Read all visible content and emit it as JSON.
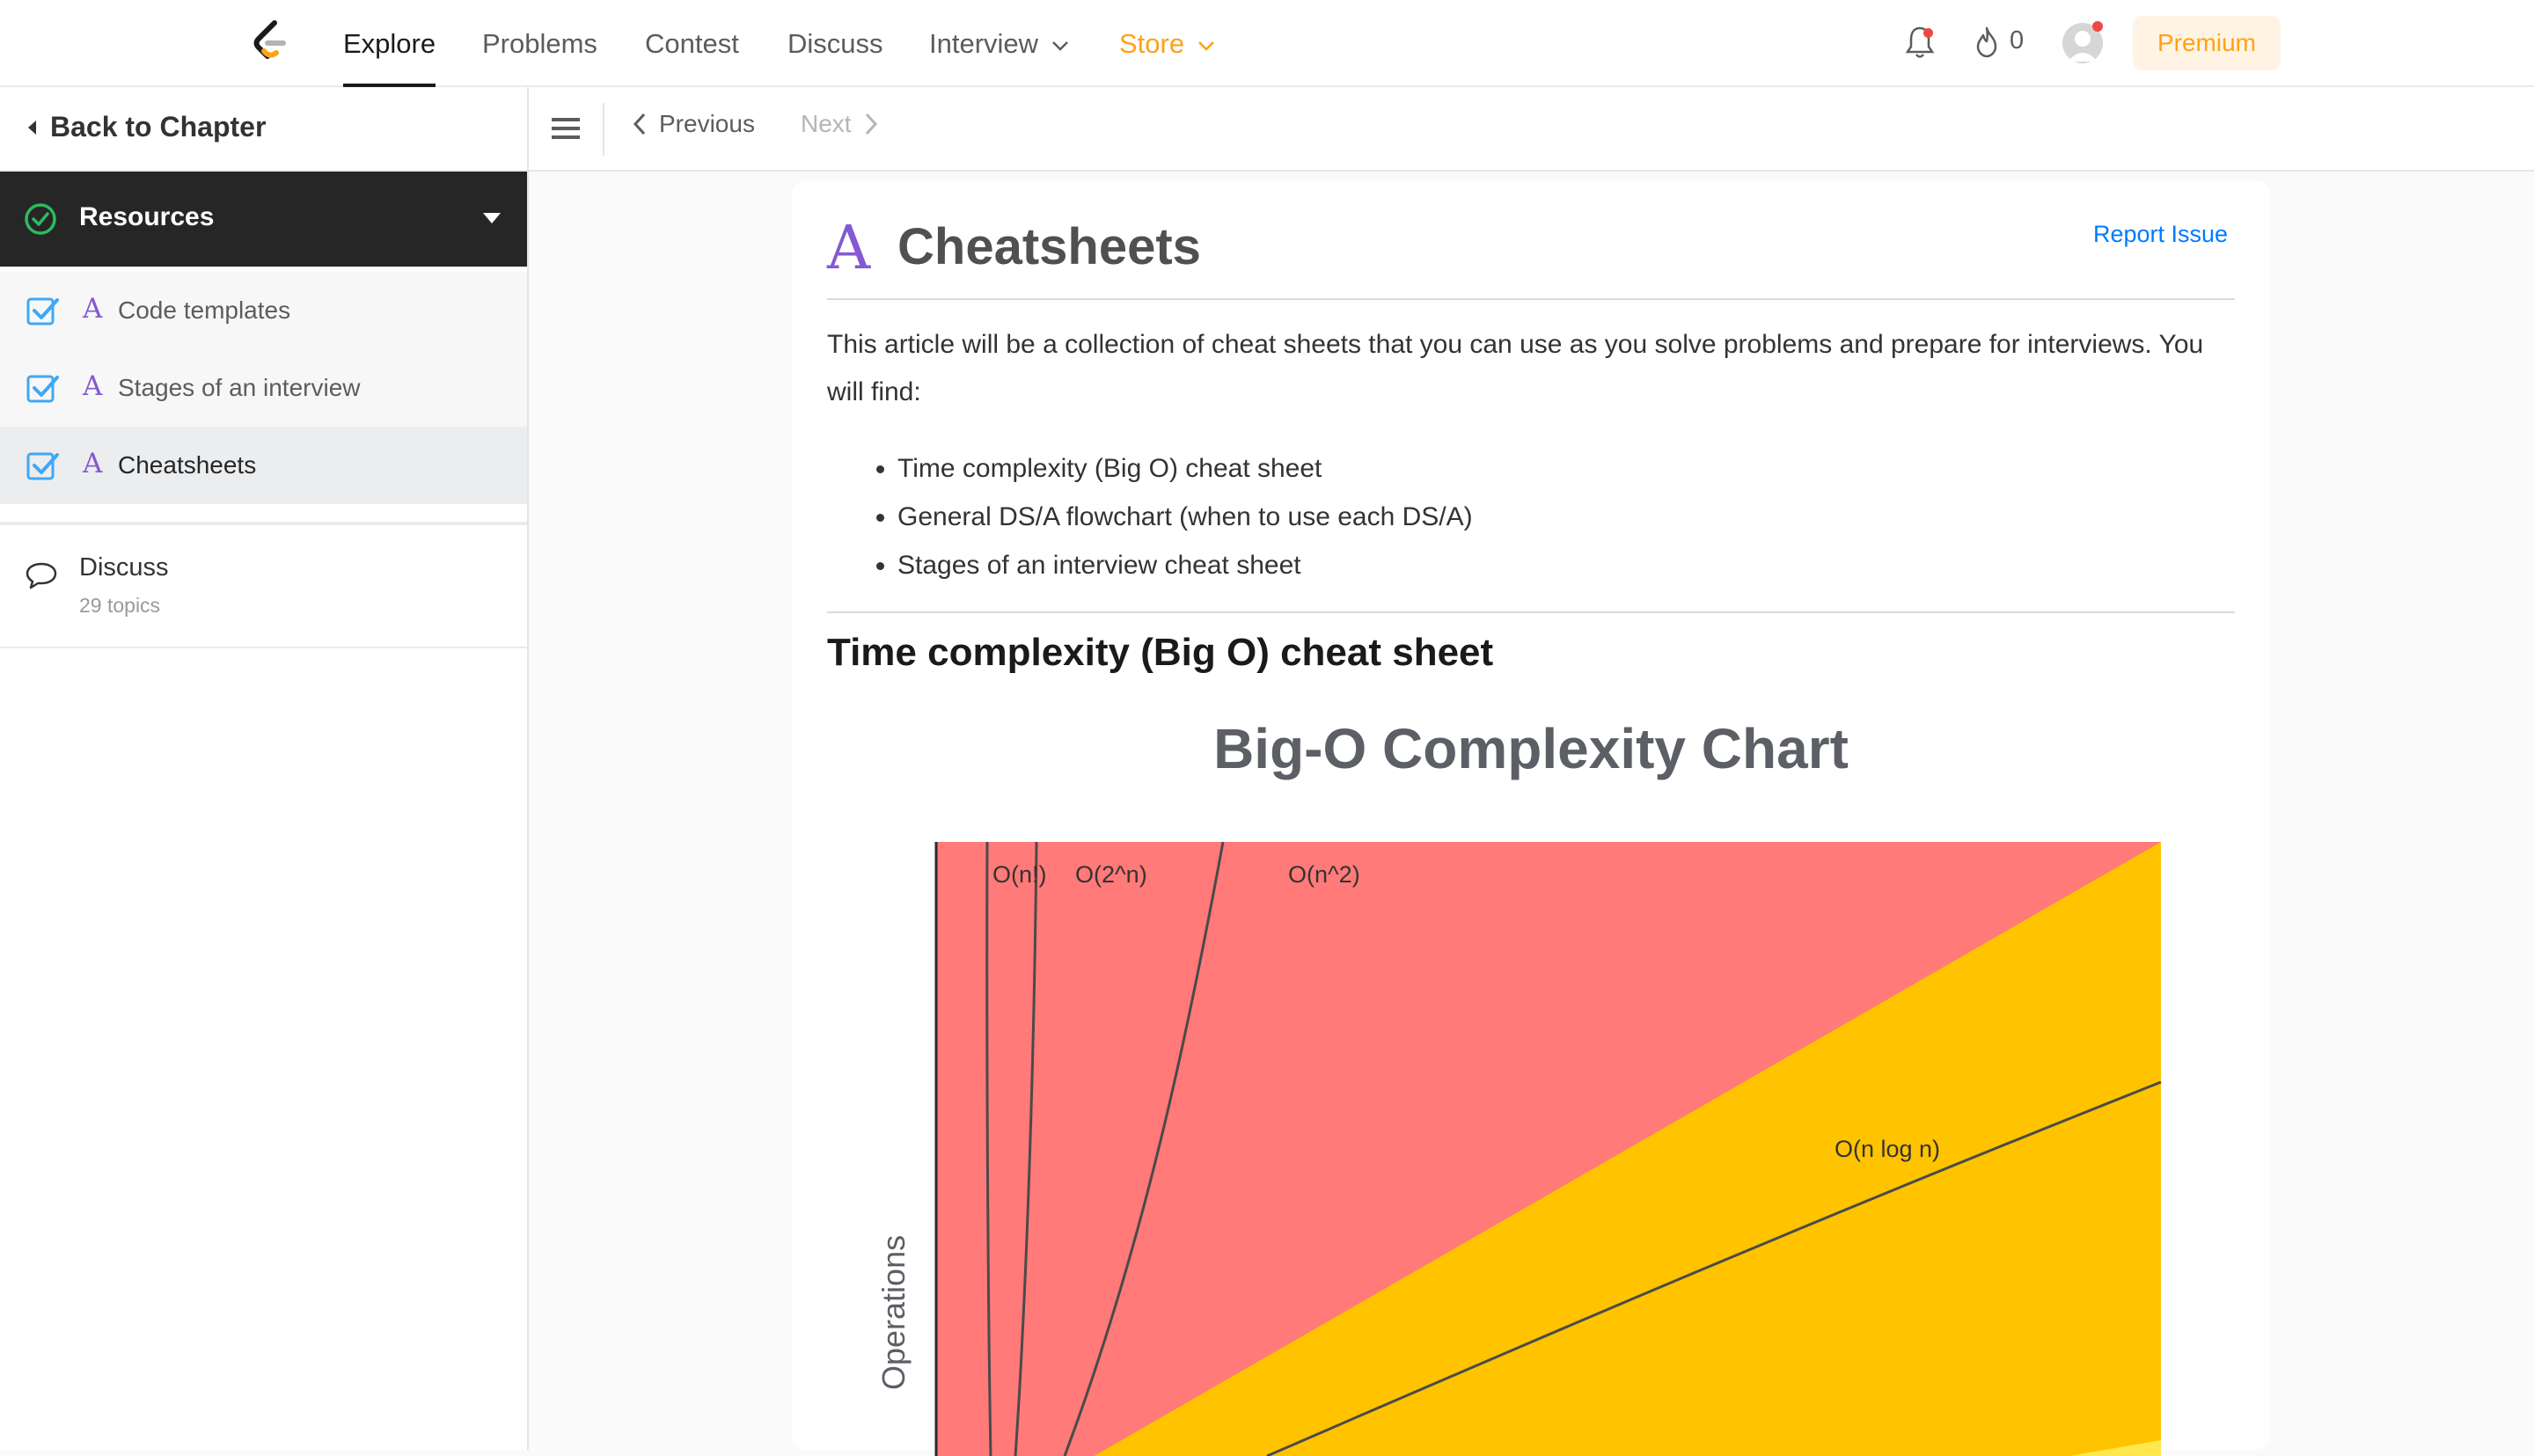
{
  "nav": {
    "items": [
      {
        "label": "Explore",
        "active": true
      },
      {
        "label": "Problems"
      },
      {
        "label": "Contest"
      },
      {
        "label": "Discuss"
      },
      {
        "label": "Interview",
        "dropdown": true
      },
      {
        "label": "Store",
        "dropdown": true,
        "color": "#ffa116"
      }
    ],
    "fire_count": "0",
    "premium_label": "Premium",
    "icons": [
      "logo-icon",
      "bell-icon",
      "fire-icon",
      "avatar"
    ]
  },
  "sidebar": {
    "back_label": "Back to Chapter",
    "section_label": "Resources",
    "items": [
      {
        "glyph": "A",
        "label": "Code templates",
        "checked": true
      },
      {
        "glyph": "A",
        "label": "Stages of an interview",
        "checked": true
      },
      {
        "glyph": "A",
        "label": "Cheatsheets",
        "checked": true,
        "active": true
      }
    ],
    "discuss": {
      "label": "Discuss",
      "sub": "29 topics"
    }
  },
  "toolbar": {
    "prev_label": "Previous",
    "next_label": "Next"
  },
  "article": {
    "glyph": "A",
    "title": "Cheatsheets",
    "report_label": "Report Issue",
    "intro": "This article will be a collection of cheat sheets that you can use as you solve problems and prepare for interviews. You will find:",
    "bullets": [
      "Time complexity (Big O) cheat sheet",
      "General DS/A flowchart (when to use each DS/A)",
      "Stages of an interview cheat sheet"
    ],
    "section_heading": "Time complexity (Big O) cheat sheet"
  },
  "colors": {
    "accent_orange": "#ffa116",
    "purple_glyph": "#8559d1",
    "link_blue": "#007aff",
    "chart_red": "#ff7a78",
    "chart_orange": "#ffc300",
    "chart_yellow": "#ffe74d"
  },
  "chart_data": {
    "type": "line",
    "title": "Big-O Complexity Chart",
    "ylabel": "Operations",
    "xlabel": "",
    "series": [
      {
        "name": "O(n!)"
      },
      {
        "name": "O(2^n)"
      },
      {
        "name": "O(n^2)"
      },
      {
        "name": "O(n log n)"
      }
    ],
    "regions": [
      "red",
      "orange",
      "yellow"
    ]
  }
}
